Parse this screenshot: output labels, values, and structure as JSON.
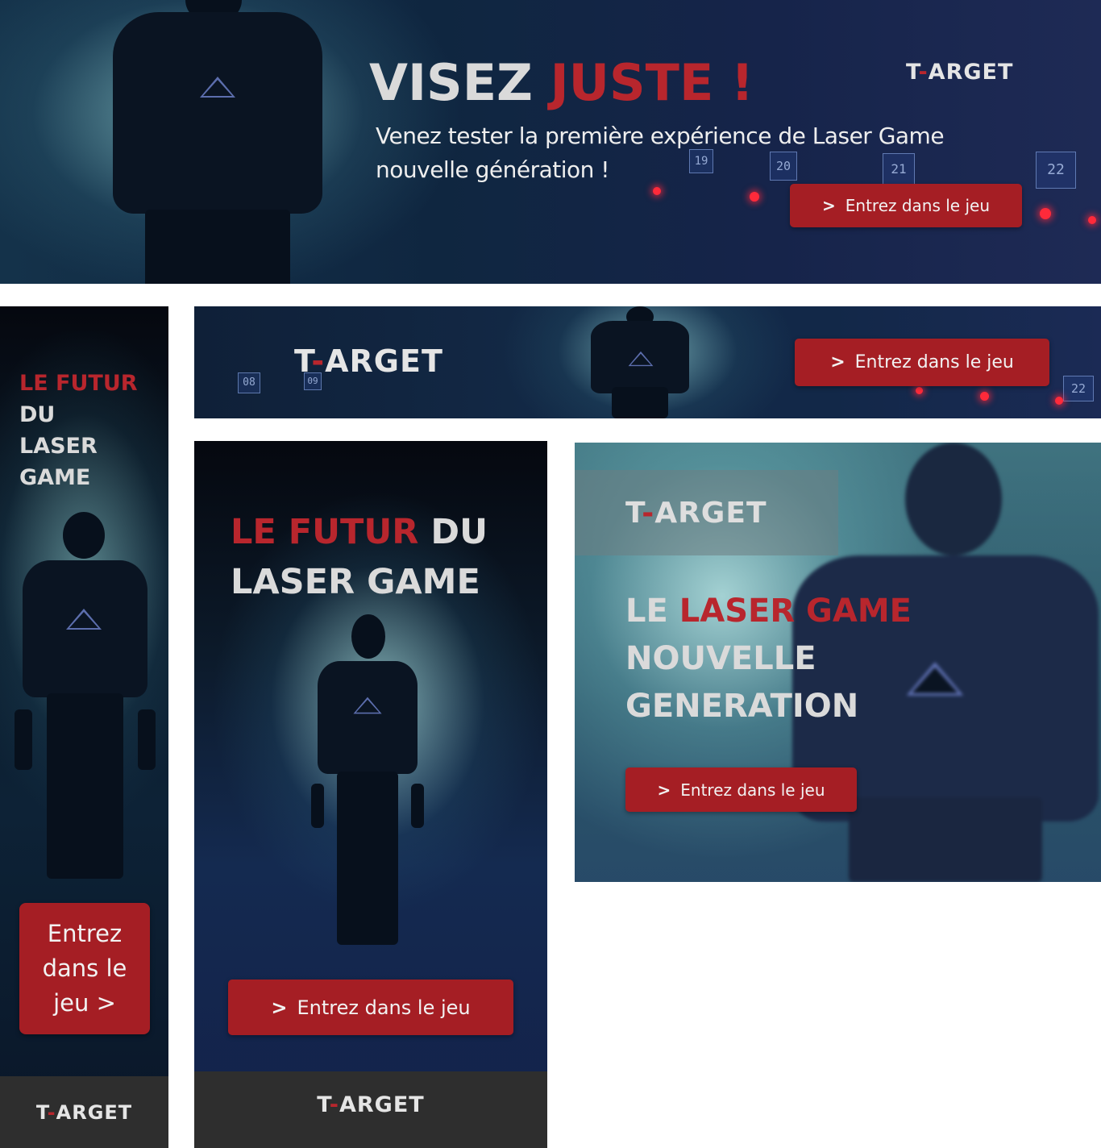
{
  "brand": {
    "prefix": "T",
    "dash": "-",
    "suffix": "ARGET"
  },
  "cta_label": "Entrez dans le jeu",
  "cta_arrow": ">",
  "cta_vertical": {
    "line1": "Entrez",
    "line2": "dans le",
    "line3": "jeu >"
  },
  "leaderboard": {
    "headline_white": "VISEZ",
    "headline_red": "JUSTE !",
    "subtitle_line1": "Venez tester la première expérience de Laser Game",
    "subtitle_line2": "nouvelle génération !",
    "screens": [
      "19",
      "20",
      "21",
      "22"
    ]
  },
  "skyscraper": {
    "line1": "LE FUTUR",
    "line2": "DU",
    "line3": "LASER",
    "line4": "GAME"
  },
  "wide_banner": {
    "screens_left": [
      "08",
      "09"
    ],
    "screen_right": "22"
  },
  "half_page": {
    "line1_red": "LE FUTUR",
    "line1_white": "DU",
    "line2": "LASER GAME"
  },
  "rectangle": {
    "line1_white": "LE",
    "line1_red": "LASER GAME",
    "line2": "NOUVELLE",
    "line3": "GENERATION"
  },
  "colors": {
    "accent_red": "#a51e24",
    "footer_dark": "#2e2e2e"
  }
}
